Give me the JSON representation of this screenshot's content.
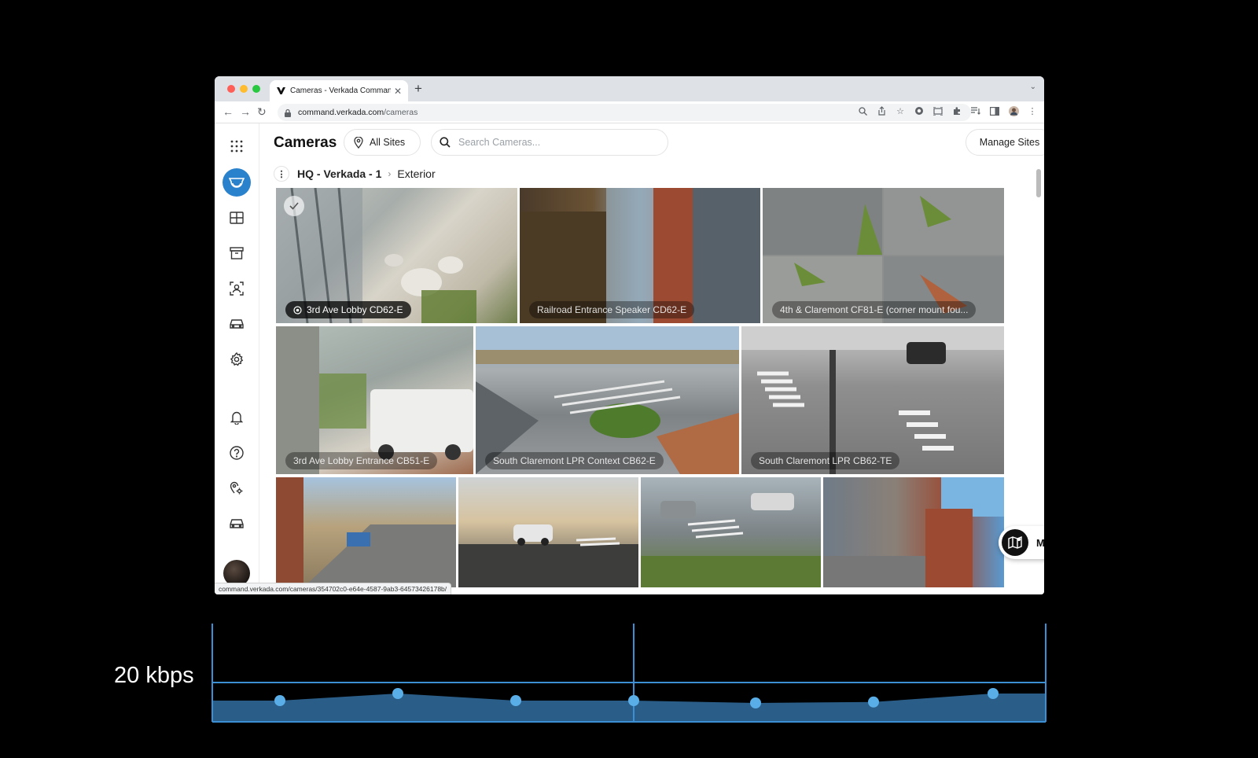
{
  "browser": {
    "tab_title": "Cameras - Verkada Command",
    "url_host": "command.verkada.com",
    "url_path": "/cameras",
    "status_url": "command.verkada.com/cameras/354702c0-e64e-4587-9ab3-64573426178b/"
  },
  "header": {
    "title": "Cameras",
    "sites_label": "All Sites",
    "search_placeholder": "Search Cameras...",
    "manage_label": "Manage Sites"
  },
  "breadcrumb": {
    "site": "HQ - Verkada - 1",
    "folder": "Exterior"
  },
  "sidebar": {
    "items": [
      "apps-grid-icon",
      "camera-icon",
      "layout-icon",
      "archive-icon",
      "person-scan-icon",
      "vehicle-icon",
      "settings-icon",
      "bell-icon",
      "help-icon",
      "location-settings-icon",
      "car-icon"
    ]
  },
  "cameras": [
    {
      "name": "3rd Ave Lobby CD62-E"
    },
    {
      "name": "Railroad Entrance Speaker CD62-E"
    },
    {
      "name": "4th & Claremont CF81-E (corner mount fou..."
    },
    {
      "name": "3rd Ave Lobby Entrance CB51-E"
    },
    {
      "name": "South Claremont LPR Context CB62-E"
    },
    {
      "name": "South Claremont LPR CB62-TE"
    },
    {
      "name": ""
    },
    {
      "name": ""
    },
    {
      "name": ""
    },
    {
      "name": ""
    }
  ],
  "map_label": "Map",
  "bandwidth": {
    "label": "20 kbps",
    "colors": {
      "line": "#3d8fd4",
      "fill": "#2a5e88",
      "point": "#5aaee8"
    }
  },
  "chart_data": {
    "type": "area",
    "series": [
      {
        "values": [
          0.45,
          0.6,
          0.45,
          0.45,
          0.4,
          0.42,
          0.6
        ]
      }
    ],
    "ylim": [
      0,
      1
    ]
  }
}
